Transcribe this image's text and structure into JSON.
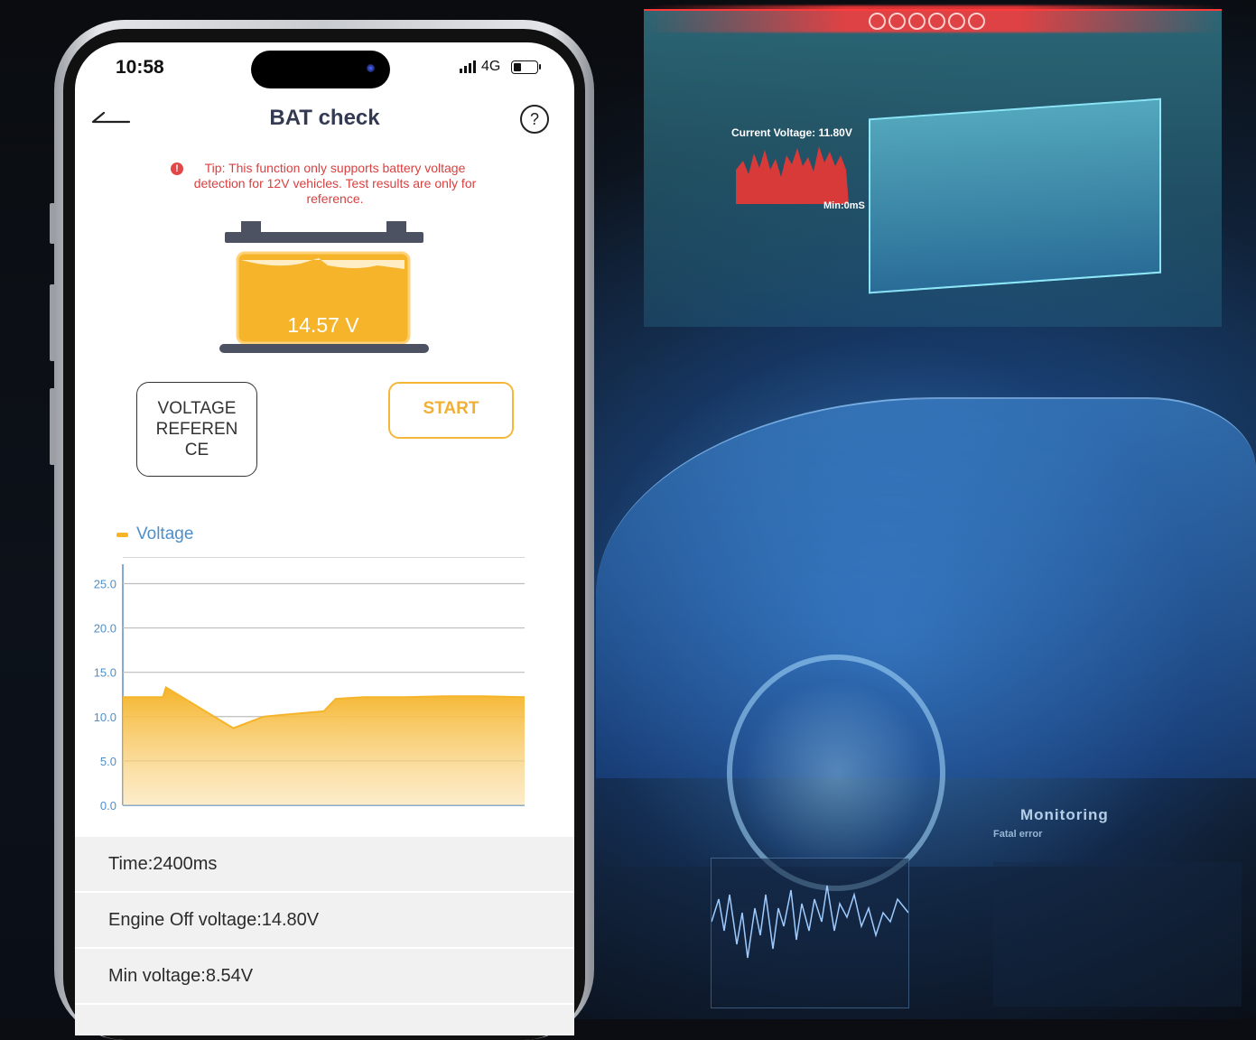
{
  "status_bar": {
    "time": "10:58",
    "network": "4G"
  },
  "app": {
    "title": "BAT check",
    "help_label": "?"
  },
  "tip": {
    "text": "Tip: This function only supports battery voltage detection for 12V vehicles. Test results are only for reference.",
    "icon": "!"
  },
  "battery": {
    "voltage": "14.57 V",
    "color": "#F5B429"
  },
  "buttons": {
    "reference_label": "VOLTAGE REFEREN CE",
    "start_label": "START"
  },
  "chart_data": {
    "type": "area",
    "series": [
      {
        "name": "Voltage",
        "values": [
          12.2,
          12.2,
          12.2,
          13.3,
          8.7,
          10.0,
          10.2,
          10.6,
          12.0,
          12.2,
          12.2,
          12.3,
          12.3,
          12.2
        ]
      }
    ],
    "x": [
      0,
      1,
      2,
      2.15,
      5.5,
      7,
      8,
      10,
      10.6,
      12,
      14,
      16,
      18,
      20
    ],
    "yticks": [
      "0.0",
      "5.0",
      "10.0",
      "15.0",
      "20.0",
      "25.0"
    ],
    "ylim": [
      0,
      28
    ],
    "grid": true,
    "legend": "top-left"
  },
  "results": {
    "time": "Time:2400ms",
    "engine_off": "Engine Off voltage:14.80V",
    "min_voltage": "Min voltage:8.54V"
  },
  "background": {
    "holo_voltage": "Current Voltage: 11.80V",
    "holo_min": "Min:0mS",
    "monitoring": "Monitoring",
    "fatal": "Fatal error"
  }
}
